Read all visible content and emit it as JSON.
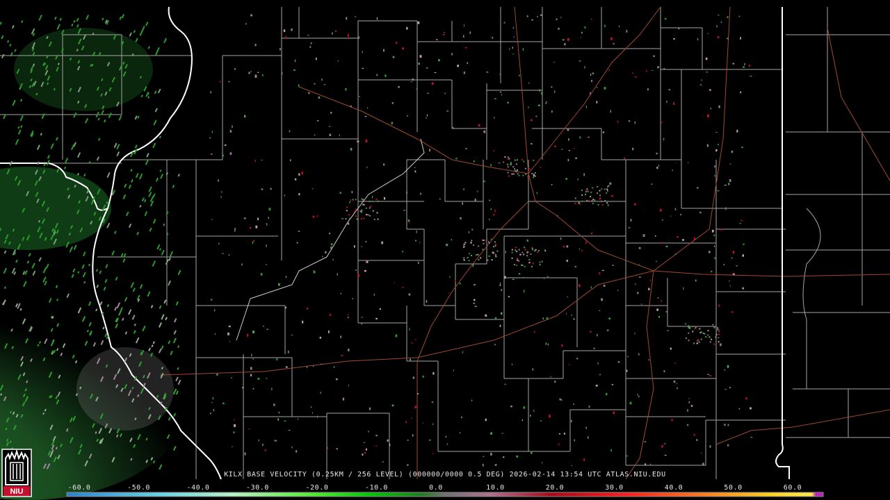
{
  "caption": {
    "station": "KILX BASE VELOCITY (0.25KM / 256 LEVEL)",
    "code": "(000000/0000 0.5 DEG)",
    "timestamp": "2026-02-14 13:54 UTC",
    "site": "ATLAS.NIU.EDU"
  },
  "legend": {
    "ticks": [
      "-60.0",
      "-50.0",
      "-40.0",
      "-30.0",
      "-20.0",
      "-10.0",
      "0.0",
      "10.0",
      "20.0",
      "30.0",
      "40.0",
      "50.0",
      "60.0"
    ],
    "colors": [
      "#3a8dd8",
      "#5fd0e6",
      "#b8f0c0",
      "#66ff33",
      "#00d000",
      "#1a7f1a",
      "#707070",
      "#b07090",
      "#c01020",
      "#ff2020",
      "#ff7020",
      "#ffd020",
      "#c020c0"
    ]
  },
  "logo": {
    "text": "NIU",
    "colors": {
      "box": "#c8102e",
      "text": "#ffffff"
    }
  },
  "map_colors": {
    "state_border": "#ffffff",
    "county_border": "#a6a6a6",
    "highway": "#a04a30",
    "background": "#000000"
  }
}
